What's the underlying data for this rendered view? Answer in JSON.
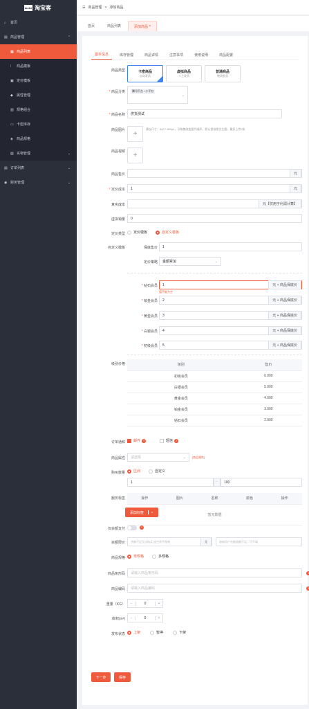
{
  "app": {
    "logo_mark": "taoke",
    "logo": "淘宝客"
  },
  "sidebar": {
    "items": [
      {
        "label": "首页",
        "icon": "home-icon",
        "level": 0
      },
      {
        "label": "商品管理",
        "icon": "shop-icon",
        "level": 0,
        "expanded": true
      },
      {
        "label": "商品列表",
        "icon": "list-icon",
        "level": 1,
        "active": true
      },
      {
        "label": "商品模板",
        "icon": "template-icon",
        "level": 1
      },
      {
        "label": "定价模板",
        "icon": "price-icon",
        "level": 1
      },
      {
        "label": "属性管理",
        "icon": "attr-icon",
        "level": 1
      },
      {
        "label": "规格组合",
        "icon": "spec-icon",
        "level": 1
      },
      {
        "label": "卡密库存",
        "icon": "card-icon",
        "level": 1
      },
      {
        "label": "商品规格",
        "icon": "sku-icon",
        "level": 1
      },
      {
        "label": "实物管理",
        "icon": "box-icon",
        "level": 1,
        "collapsed": true
      },
      {
        "label": "订单列表",
        "icon": "order-icon",
        "level": 0,
        "collapsed": true
      },
      {
        "label": "财务管理",
        "icon": "finance-icon",
        "level": 0,
        "collapsed": true
      }
    ]
  },
  "breadcrumb": [
    "商品管理",
    "添加商品"
  ],
  "page_tabs": [
    "首页",
    "商品列表",
    "添加商品"
  ],
  "form_tabs": [
    "基本信息",
    "库存管理",
    "商品详情",
    "注意事项",
    "使用说明",
    "商品配置"
  ],
  "form": {
    "type_label": "商品类型",
    "types": [
      {
        "name": "卡密商品",
        "desc": "自动发货"
      },
      {
        "name": "虚拟商品",
        "desc": "人工发货"
      },
      {
        "name": "普通商品",
        "desc": "物流发货"
      }
    ],
    "category_label": "商品分类",
    "category_value": "腾讯平台 / 小平台",
    "name_label": "商品名称",
    "name_value": "供货测试",
    "image_label": "商品图片",
    "image_hint": "建议尺寸：800 * 800px，可拖拽改变图片顺序，默认首张图为主图，最多上传9张",
    "video_label": "商品视频",
    "price_label": "商品售价",
    "price_unit": "元",
    "cost_label": "定价成本",
    "cost_value": "1",
    "cost_unit": "元",
    "real_cost_label": "真实成本",
    "real_cost_addon": "元【仅用于利润计算】",
    "virtual_sales_label": "虚拟销量",
    "virtual_sales_value": "0",
    "pricing_type_label": "定价类型",
    "pricing_options": [
      "定价模板",
      "自定义模板"
    ],
    "custom_label": "自定义模板",
    "base_price_label": "保底售价",
    "base_price_value": "1",
    "strategy_label": "定价策略",
    "strategy_value": "金额累加",
    "levels": [
      {
        "label": "钻石会员",
        "value": "1",
        "addon": "元 + 商品保底价",
        "error": "值不能为空"
      },
      {
        "label": "铂金会员",
        "value": "2",
        "addon": "元 + 商品保底价"
      },
      {
        "label": "黄金会员",
        "value": "3",
        "addon": "元 + 商品保底价"
      },
      {
        "label": "白银会员",
        "value": "4",
        "addon": "元 + 商品保底价"
      },
      {
        "label": "初级会员",
        "value": "5",
        "addon": "元 + 商品保底价"
      }
    ],
    "level_price_label": "级别价格",
    "level_table": {
      "headers": [
        "级别",
        "售价"
      ],
      "rows": [
        [
          "初级会员",
          "6.000"
        ],
        [
          "白银会员",
          "5.000"
        ],
        [
          "黄金会员",
          "4.000"
        ],
        [
          "铂金会员",
          "3.000"
        ],
        [
          "钻石会员",
          "2.000"
        ]
      ]
    },
    "notify_label": "订单通知",
    "notify_options": [
      "邮件",
      "短信"
    ],
    "attr_label": "商品属性",
    "attr_placeholder": "请选择",
    "attr_link": "[商品属性]",
    "qty_label": "购买数量",
    "qty_options": [
      "区间",
      "自定义"
    ],
    "qty_min": "1",
    "qty_sep": "-",
    "qty_max": "100",
    "service_label": "服务标签",
    "service_headers": [
      "操作",
      "图片",
      "名称",
      "颜色",
      "操作"
    ],
    "service_empty": "暂无数据",
    "add_tag_button": "添加标签",
    "balance_label": "仅余额支付",
    "limit_label": "余额限价",
    "limit_placeholder": "余额不足无法购买,留空则不限制",
    "limit_unit": "元",
    "limit_placeholder2": "限制用户余额限额不足，可不填",
    "spec_label": "商品规格",
    "spec_options": [
      "单规格",
      "多规格"
    ],
    "barcode_label": "商品条形码",
    "barcode_placeholder": "请输入商品条形码",
    "code_label": "商品编码",
    "code_placeholder": "请输入商品编码",
    "weight_label": "重量（KG）",
    "weight_value": "0",
    "volume_label": "体积(m³)",
    "volume_value": "0",
    "status_label": "发布状态",
    "status_options": [
      "上架",
      "暂停",
      "下架"
    ],
    "prev_button": "下一步",
    "save_button": "保存"
  }
}
